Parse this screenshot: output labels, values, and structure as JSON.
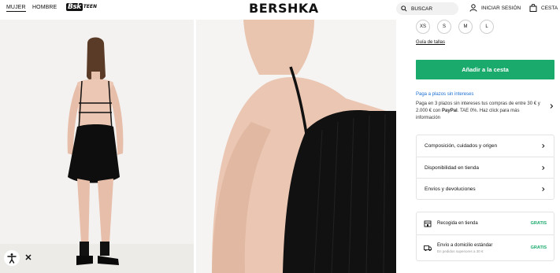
{
  "header": {
    "nav": [
      "MUJER",
      "HOMBRE"
    ],
    "teen_logo": {
      "bsk": "Bsk",
      "teen": "TEEN"
    },
    "brand": "BERSHKA",
    "search_label": "BUSCAR",
    "login_label": "INICIAR SESIÓN",
    "cart_label": "CESTA"
  },
  "product": {
    "sizes": [
      "XS",
      "S",
      "M",
      "L"
    ],
    "size_guide": "Guía de tallas",
    "add_to_cart": "Añadir a la cesta"
  },
  "payment": {
    "title": "Paga a plazos sin intereses",
    "desc_pre": "Paga en 3 plazos sin intereses tus compras de entre 30 € y 2.000 € con ",
    "desc_brand": "PayPal",
    "desc_post": ". TAE 0%. Haz click para más información"
  },
  "accordion": [
    "Composición, cuidados y origen",
    "Disponibilidad en tienda",
    "Envíos y devoluciones"
  ],
  "shipping": [
    {
      "label": "Recogida en tienda",
      "sub": "",
      "price": "GRATIS",
      "icon": "store-icon"
    },
    {
      "label": "Envío a domicilio estándar",
      "sub": "En pedidos superiores a 30 €",
      "price": "GRATIS",
      "icon": "truck-icon"
    }
  ],
  "colors": {
    "accent": "#1aaa6c",
    "link": "#1a6fd1"
  }
}
